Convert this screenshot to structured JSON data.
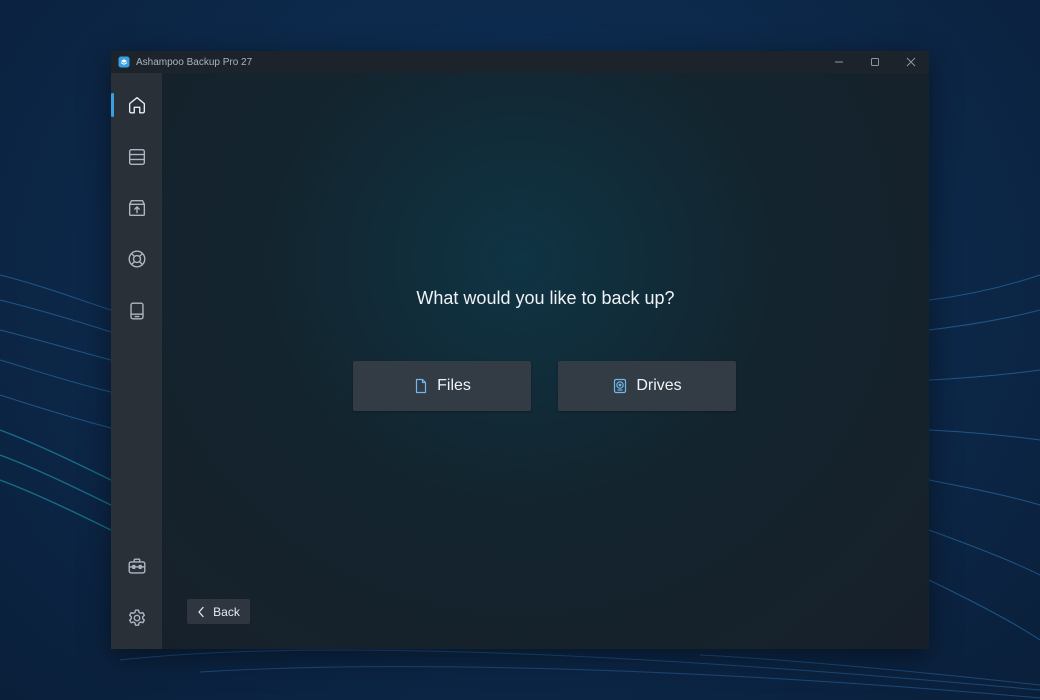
{
  "window": {
    "title": "Ashampoo Backup Pro 27"
  },
  "titlebar": {
    "controls": [
      {
        "name": "minimize-button",
        "icon": "minimize-icon"
      },
      {
        "name": "maximize-button",
        "icon": "maximize-icon"
      },
      {
        "name": "close-button",
        "icon": "close-icon"
      }
    ]
  },
  "sidebar": {
    "items": [
      {
        "name": "sidebar-item-home",
        "icon": "home-icon",
        "active": true
      },
      {
        "name": "sidebar-item-backup-plans",
        "icon": "storage-stack-icon",
        "active": false
      },
      {
        "name": "sidebar-item-restore",
        "icon": "box-upload-icon",
        "active": false
      },
      {
        "name": "sidebar-item-rescue",
        "icon": "lifebuoy-icon",
        "active": false
      },
      {
        "name": "sidebar-item-drives",
        "icon": "tablet-drive-icon",
        "active": false
      },
      {
        "name": "sidebar-item-tools",
        "icon": "toolbox-icon",
        "active": false
      },
      {
        "name": "sidebar-item-settings",
        "icon": "gear-icon",
        "active": false
      }
    ]
  },
  "main": {
    "question": "What would you like to back up?",
    "choices": [
      {
        "label": "Files",
        "icon": "file-icon"
      },
      {
        "label": "Drives",
        "icon": "drive-icon"
      }
    ],
    "back_label": "Back"
  },
  "colors": {
    "accent": "#3a9fe0",
    "icon_accent": "#6db8ec",
    "sidebar_bg": "#2a3038",
    "button_bg": "#333b45"
  }
}
